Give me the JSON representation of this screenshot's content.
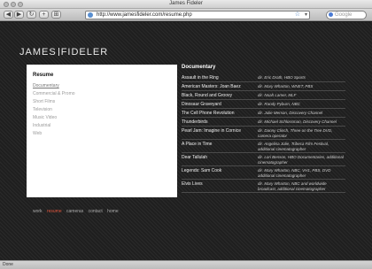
{
  "window": {
    "title": "James Fideler"
  },
  "toolbar": {
    "back": "◀",
    "forward": "▶",
    "reload": "↻",
    "add": "+",
    "rss": "⊞",
    "url": "http://www.jamesfideler.com/resume.php",
    "search_placeholder": "Google"
  },
  "site": {
    "logo_left": "JAMES",
    "logo_right": "FIDELER"
  },
  "sidebar": {
    "heading": "Resume",
    "items": [
      "Documentary",
      "Commercial & Promo",
      "Short Films",
      "Television",
      "Music Video",
      "Industrial",
      "Web"
    ]
  },
  "content": {
    "heading": "Documentary",
    "rows": [
      {
        "title": "Assault in the Ring",
        "credit": "dir. Eric Drath, HBO Sports"
      },
      {
        "title": "American Masters: Joan Baez",
        "credit": "dir. Mary Wharton, WNET, PBS"
      },
      {
        "title": "Black, Round and Groovy",
        "credit": "dir. Noah Lamer, MLF"
      },
      {
        "title": "Dinosaur Graveyard",
        "credit": "dir. Randy Pyburn, NBC"
      },
      {
        "title": "The Cell Phone Revolution",
        "credit": "dir. Julie Merson, Discovery Channel"
      },
      {
        "title": "Thunderbirds",
        "credit": "dir. Michael Schlossman, Discovery Channel"
      },
      {
        "title": "Pearl Jam: Imagine in Cornice",
        "credit": "dir. Danny Clinch, Three on the Tree DVD, camera operator"
      },
      {
        "title": "A Place in Time",
        "credit": "dir. Angelina Jolie, Tribeca Film Festival, additional cinematographer"
      },
      {
        "title": "Dear Tallulah",
        "credit": "dir. Lori Benson, HBO Documentaries, additional cinematographer"
      },
      {
        "title": "Legends: Sam Cook",
        "credit": "dir. Mary Wharton, NBC, VH1, PBS, DVD additional cinematographer"
      },
      {
        "title": "Elvis Lives",
        "credit": "dir. Mary Wharton, NBC and worldwide broadcast, additional cinematographer"
      }
    ]
  },
  "footer_nav": [
    "work",
    "resume",
    "cameras",
    "contact",
    "home"
  ],
  "status": {
    "text": "Done"
  },
  "colors": {
    "accent": "#e0553d",
    "background": "#1f1f1f"
  }
}
